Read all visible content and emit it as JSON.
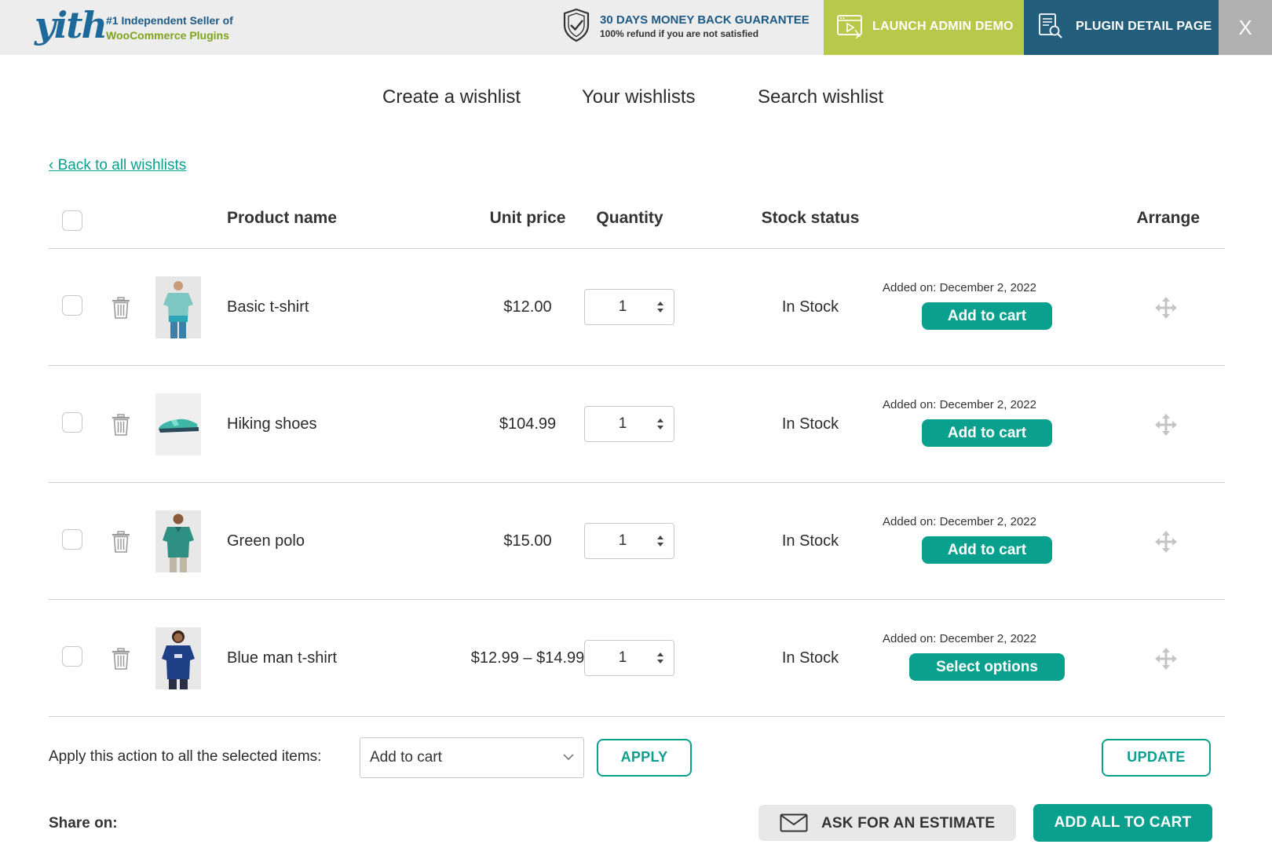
{
  "topbar": {
    "logo": "yith",
    "seller_line1": "#1 Independent Seller of",
    "seller_line2": "WooCommerce Plugins",
    "guarantee_title": "30 DAYS MONEY BACK GUARANTEE",
    "guarantee_sub": "100% refund if you are not satisfied",
    "demo_label": "LAUNCH ADMIN DEMO",
    "detail_label": "PLUGIN DETAIL PAGE",
    "close_label": "X",
    "colors": {
      "bar": "#ededed",
      "demo": "#b6c94a",
      "detail": "#235f7c",
      "close": "#b0b0b0"
    }
  },
  "nav": {
    "items": [
      "Create a wishlist",
      "Your wishlists",
      "Search wishlist"
    ]
  },
  "back_link": "‹ Back to all wishlists",
  "table": {
    "headers": {
      "product": "Product name",
      "price": "Unit price",
      "quantity": "Quantity",
      "stock": "Stock status",
      "arrange": "Arrange"
    },
    "rows": [
      {
        "name": "Basic t-shirt",
        "price": "$12.00",
        "qty": "1",
        "stock": "In Stock",
        "added": "Added on: December 2, 2022",
        "action": "Add to cart",
        "thumb": "basic-tshirt-image"
      },
      {
        "name": "Hiking shoes",
        "price": "$104.99",
        "qty": "1",
        "stock": "In Stock",
        "added": "Added on: December 2, 2022",
        "action": "Add to cart",
        "thumb": "hiking-shoes-image"
      },
      {
        "name": "Green polo",
        "price": "$15.00",
        "qty": "1",
        "stock": "In Stock",
        "added": "Added on: December 2, 2022",
        "action": "Add to cart",
        "thumb": "green-polo-image"
      },
      {
        "name": "Blue man t-shirt",
        "price": "$12.99 – $14.99",
        "qty": "1",
        "stock": "In Stock",
        "added": "Added on: December 2, 2022",
        "action": "Select options",
        "thumb": "blue-tshirt-image"
      }
    ]
  },
  "actions": {
    "apply_label": "Apply this action to all the selected items:",
    "select_value": "Add to cart",
    "apply_button": "APPLY",
    "update_button": "UPDATE"
  },
  "share": {
    "label": "Share on:",
    "estimate_button": "ASK FOR AN ESTIMATE",
    "add_all_button": "ADD ALL TO CART"
  },
  "accent_color": "#0aa08e"
}
